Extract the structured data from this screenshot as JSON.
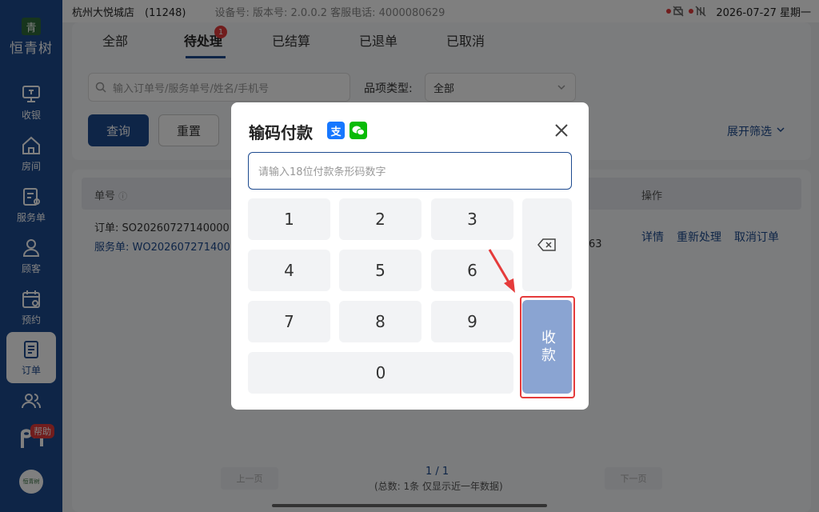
{
  "statusbar": {
    "store": "杭州大悦城店　(11248)",
    "device_info": "设备号: 版本号: 2.0.0.2 客服电话: 4000080629",
    "datetime": "2026-07-27 星期一"
  },
  "sidebar": {
    "logo_char": "青",
    "logo_text": "恒青树",
    "items": [
      {
        "label": "收银",
        "icon": "cashier-icon"
      },
      {
        "label": "房间",
        "icon": "room-icon"
      },
      {
        "label": "服务单",
        "icon": "service-order-icon"
      },
      {
        "label": "顾客",
        "icon": "customer-icon"
      },
      {
        "label": "预约",
        "icon": "calendar-icon"
      },
      {
        "label": "订单",
        "icon": "order-icon"
      },
      {
        "label": "",
        "icon": "staff-icon"
      }
    ],
    "help_badge": "帮助",
    "avatar_text": "恒青树"
  },
  "tabs": [
    {
      "label": "全部"
    },
    {
      "label": "待处理",
      "badge": "1"
    },
    {
      "label": "已结算"
    },
    {
      "label": "已退单"
    },
    {
      "label": "已取消"
    }
  ],
  "filters": {
    "search_placeholder": "输入订单号/服务单号/姓名/手机号",
    "category_label": "品项类型:",
    "category_value": "全部",
    "query": "查询",
    "reset": "重置",
    "expand": "展开筛选"
  },
  "table": {
    "col_order": "单号",
    "col_ops": "操作",
    "row": {
      "order_no": "订单: SO20260727140000",
      "service_no": "服务单: WO202607271400",
      "amount_fragment": "63",
      "ops": [
        "详情",
        "重新处理",
        "取消订单"
      ]
    }
  },
  "pager": {
    "prev": "上一页",
    "next": "下一页",
    "page": "1 / 1",
    "info": "(总数: 1条 仅显示近一年数据)"
  },
  "modal": {
    "title": "输码付款",
    "alipay_char": "支",
    "input_placeholder": "请输入18位付款条形码数字",
    "keys": [
      "1",
      "2",
      "3",
      "4",
      "5",
      "6",
      "7",
      "8",
      "9",
      "0"
    ],
    "pay_label": "收款"
  },
  "colors": {
    "primary": "#1d4a8f",
    "alipay": "#1677ff",
    "wechat": "#09bb07",
    "annotation_red": "#e53b3b"
  }
}
